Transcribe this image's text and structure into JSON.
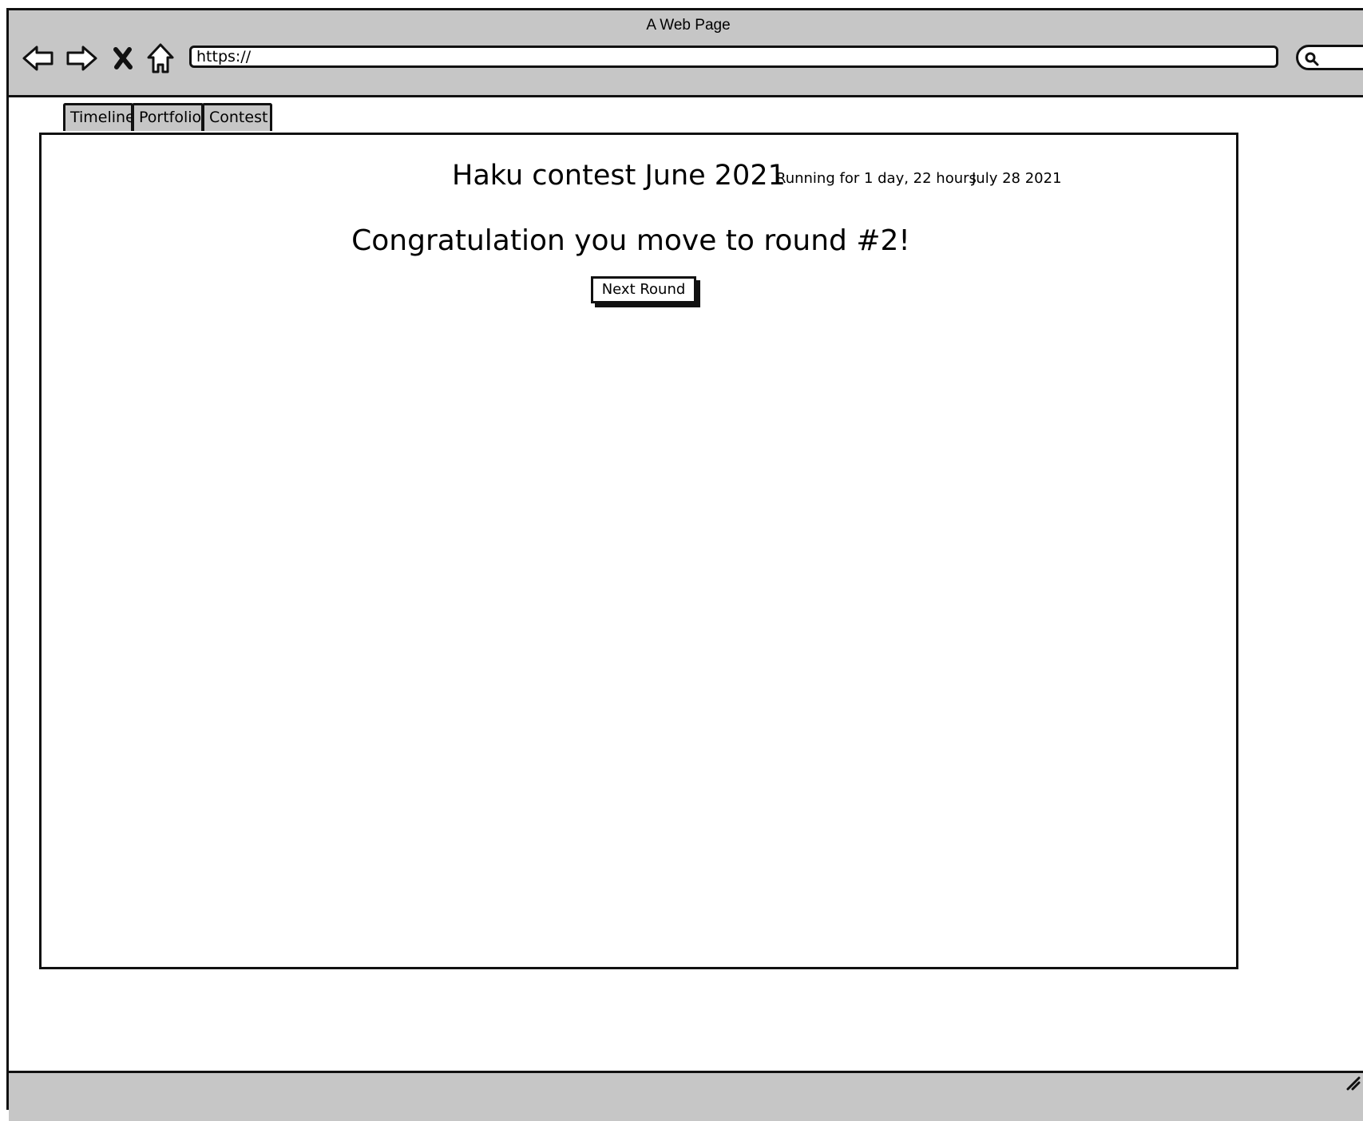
{
  "window": {
    "title": "A Web Page"
  },
  "toolbar": {
    "back_icon": "back-arrow-icon",
    "forward_icon": "forward-arrow-icon",
    "stop_icon": "close-x-icon",
    "home_icon": "home-icon",
    "url": "https://",
    "search_icon": "search-icon"
  },
  "tabs": [
    {
      "label": "Timeline"
    },
    {
      "label": "Portfolio"
    },
    {
      "label": "Contest"
    }
  ],
  "contest": {
    "title": "Haku contest June 2021",
    "running": "Running for 1 day, 22 hours",
    "date": "July 28 2021",
    "message": "Congratulation you move to round #2!",
    "next_button_label": "Next Round"
  },
  "colors": {
    "chrome": "#c6c6c6",
    "border": "#111111",
    "background": "#ffffff"
  }
}
